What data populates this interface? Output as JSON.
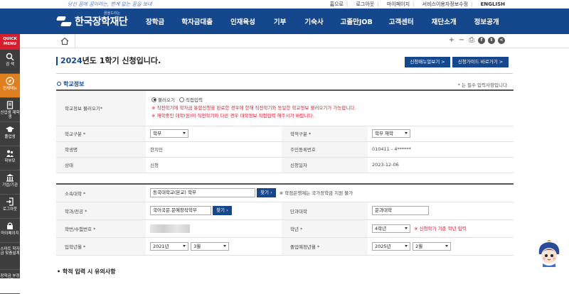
{
  "top": {
    "slogan": "당신 꿈에 꿈이라는, 한계 없는 꿈을 보내",
    "links": [
      "홈으로",
      "로그아웃",
      "마이페이지",
      "서비스이용자정보수정",
      "ENGLISH"
    ]
  },
  "brand": {
    "small": "꿈을드리는",
    "name": "한국장학재단"
  },
  "nav": [
    "장학금",
    "학자금대출",
    "인재육성",
    "기부",
    "기숙사",
    "고졸만JOB",
    "고객센터",
    "재단소개",
    "정보공개"
  ],
  "quick_menu": {
    "title": "QUICK MENU",
    "items": [
      {
        "label": "검 색",
        "icon": "search-icon"
      },
      {
        "label": "전체메뉴",
        "icon": "compass-icon"
      },
      {
        "label": "신입생 재학생",
        "icon": "document-icon"
      },
      {
        "label": "졸업생",
        "icon": "graduation-cap-icon"
      },
      {
        "label": "학부모",
        "icon": "parents-icon"
      },
      {
        "label": "기업/기관",
        "icon": "building-icon"
      },
      {
        "label": "로그아웃",
        "icon": "logout-icon"
      },
      {
        "label": "마이페이지",
        "icon": "lock-icon"
      },
      {
        "label": "스마트 학자금 맞춤설계",
        "icon": ""
      },
      {
        "label": "장학금 부정수급",
        "icon": ""
      }
    ]
  },
  "page": {
    "title_year": "2024",
    "title_rest": "년도 1학기 신청입니다.",
    "btn_manual": "신청매뉴얼보기 >",
    "btn_guide": "신청가이드 바로가기 >",
    "section_title": "학교정보",
    "required_note": "* 는 필수 입력사항입니다."
  },
  "school_info": {
    "load_label": "학교정보 불러오기*",
    "radio_load": "불러오기",
    "radio_direct": "직접입력",
    "notice1": "※ 직전학기에 학자금 통합신청을 완료한 경우에 한해 직전학기와 동일한 학교정보 불러오기가 가능합니다.",
    "notice2": "※ 재학중인 대학(원)이 직전학기와 다른 경우 대학정보 직접입력 해주시기 바랍니다.",
    "school_type_label": "학교구분 *",
    "school_type_value": "학부",
    "enroll_type_label": "학적구분 *",
    "enroll_type_value": "학부 재학",
    "student_name_label": "학생명",
    "student_name_value": "한지민",
    "rrn_label": "주민등록번호",
    "rrn_value": "010411 - 4******",
    "status_label": "상태",
    "status_value": "신청",
    "apply_date_label": "신청일자",
    "apply_date_value": "2023-12-06"
  },
  "univ": {
    "univ_label": "소속대학 *",
    "univ_value": "동국대학교(본교) 학부",
    "search_btn": "찾기",
    "univ_note": "※ 학점은행제는 국가장학금 지원 불가",
    "major_label": "학과/전공 *",
    "major_value": "국어국문.문예창작학부",
    "major_search_btn": "찾기",
    "college_label": "단과대학",
    "college_value": "문과대학",
    "student_id_label": "학번/수험번호 *",
    "grade_label": "학년 *",
    "grade_value": "4학년",
    "grade_note": "※ 신청학기 기준 학년 입력",
    "admit_label": "입학년월 *",
    "admit_year": "2021년",
    "admit_month": "3월",
    "grad_label": "졸업예정년월 *",
    "grad_year": "2025년",
    "grad_month": "2월"
  },
  "section2": "• 학적 입력 시 유의사항"
}
